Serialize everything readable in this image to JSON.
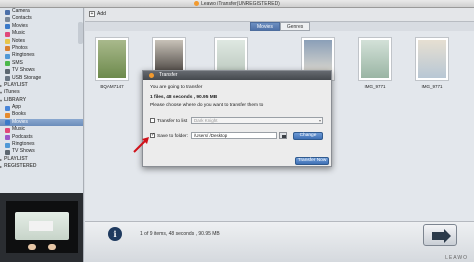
{
  "app": {
    "title": "Leawo iTransfer(UNREGISTERED)",
    "brand": "LEAWO"
  },
  "sidebar": {
    "device_items": [
      {
        "label": "Camera",
        "icon": "camera-icon",
        "color": "#4b6fa8"
      },
      {
        "label": "Contacts",
        "icon": "contacts-icon",
        "color": "#7a8899"
      },
      {
        "label": "Movies",
        "icon": "movies-icon",
        "color": "#3b7ac9"
      },
      {
        "label": "Music",
        "icon": "music-icon",
        "color": "#e0487a"
      },
      {
        "label": "Notes",
        "icon": "notes-icon",
        "color": "#e7c54a"
      },
      {
        "label": "Photos",
        "icon": "photos-icon",
        "color": "#d97f2f"
      },
      {
        "label": "Ringtones",
        "icon": "ringtones-icon",
        "color": "#4f98d6"
      },
      {
        "label": "SMS",
        "icon": "sms-icon",
        "color": "#4cb84a"
      },
      {
        "label": "TV Shows",
        "icon": "tvshows-icon",
        "color": "#5d6770"
      },
      {
        "label": "USB Storage",
        "icon": "usb-storage-icon",
        "color": "#6b7784"
      }
    ],
    "playlist_section": "PLAYLIST",
    "itunes_section": "iTunes",
    "library_section": "LIBRARY",
    "library_items": [
      {
        "label": "App",
        "icon": "app-icon",
        "color": "#4a86d8"
      },
      {
        "label": "Books",
        "icon": "books-icon",
        "color": "#e58a2e"
      },
      {
        "label": "Movies",
        "icon": "movies-icon",
        "color": "#3b7ac9",
        "selected": true
      },
      {
        "label": "Music",
        "icon": "music-icon",
        "color": "#e0487a"
      },
      {
        "label": "Podcasts",
        "icon": "podcasts-icon",
        "color": "#9a58c9"
      },
      {
        "label": "Ringtones",
        "icon": "ringtones-icon",
        "color": "#4f98d6"
      },
      {
        "label": "TV Shows",
        "icon": "tvshows-icon",
        "color": "#5d6770"
      }
    ],
    "playlist2_section": "PLAYLIST",
    "registered_section": "REGISTERED"
  },
  "toolbar": {
    "add_label": "Add"
  },
  "tabs": [
    {
      "label": "Movies",
      "active": true
    },
    {
      "label": "Genres",
      "active": false
    }
  ],
  "thumbnails": [
    {
      "label": "BQAM7147",
      "colors": [
        "#a9b98c",
        "#6d8a4c"
      ]
    },
    {
      "label": "",
      "colors": [
        "#c8c2b8",
        "#3a3532"
      ]
    },
    {
      "label": "",
      "colors": [
        "#dfe8e2",
        "#b9c6bc"
      ]
    },
    {
      "label": "",
      "colors": [
        "#8b9fb8",
        "#e6e0d2"
      ]
    },
    {
      "label": "IMG_9771",
      "colors": [
        "#d3e1d8",
        "#9ab5a4"
      ]
    },
    {
      "label": "IMG_9771",
      "colors": [
        "#e6dfd2",
        "#b8c7d4"
      ]
    }
  ],
  "status": {
    "text": "1 of 9 items, 48 seconds , 90.95 MB"
  },
  "dialog": {
    "title": "Transfer",
    "line1": "You are going to transfer",
    "line2": "1 files, 48 seconds , 90.95 MB",
    "line3": "Please choose where do you want to transfer them to",
    "transfer_to_list_label": "Transfer to list",
    "transfer_to_list_value": "Dark Knight",
    "save_to_folder_label": "Save to folder:",
    "folder_path": "/Users/             /Desktop",
    "change_label": "Change",
    "transfer_now_label": "Transfer Now"
  }
}
